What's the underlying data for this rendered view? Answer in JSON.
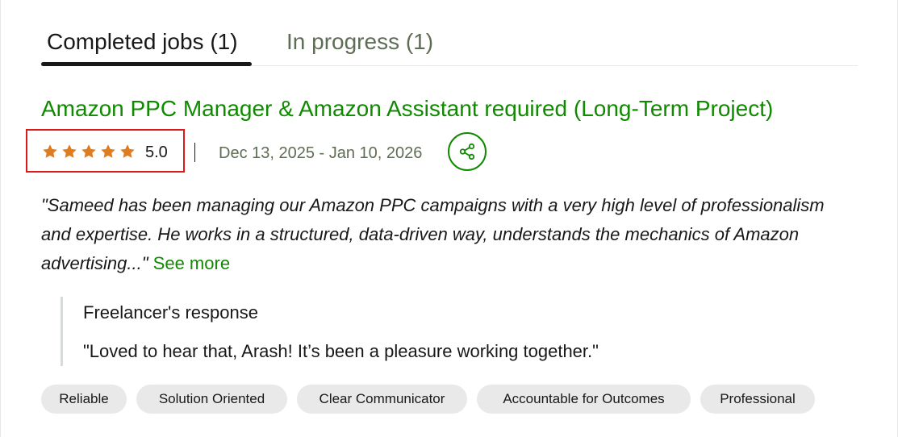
{
  "tabs": {
    "completed": "Completed jobs (1)",
    "in_progress": "In progress (1)"
  },
  "job": {
    "title": "Amazon PPC Manager & Amazon Assistant required (Long-Term Project)",
    "rating": "5.0",
    "stars": 5,
    "date_range": "Dec 13, 2025 - Jan 10, 2026",
    "review": "\"Sameed has been managing our Amazon PPC campaigns with a very high level of professionalism and expertise. He works in a structured, data-driven way, understands the mechanics of Amazon advertising...\"",
    "see_more": "See more"
  },
  "response": {
    "title": "Freelancer's response",
    "text": "\"Loved to hear that, Arash! It’s been a pleasure working together.\""
  },
  "skills": [
    "Reliable",
    "Solution Oriented",
    "Clear Communicator",
    "Accountable for Outcomes",
    "Professional"
  ],
  "icons": {
    "star": "star-icon",
    "share": "share-icon"
  },
  "colors": {
    "accent_green": "#108a00",
    "star_orange": "#e07b1f",
    "highlight_red": "#e01818",
    "chip_gray": "#e9e9e9"
  }
}
